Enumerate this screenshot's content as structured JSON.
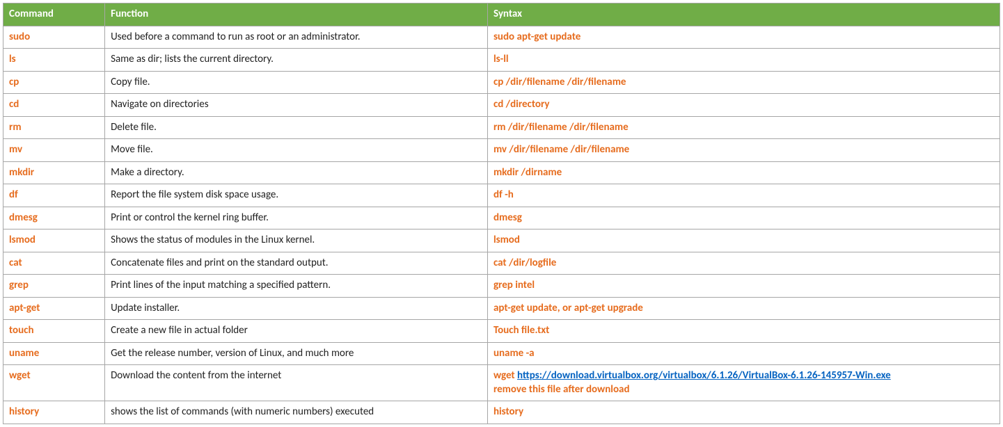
{
  "headers": {
    "command": "Command",
    "function": "Function",
    "syntax": "Syntax"
  },
  "rows": [
    {
      "command": "sudo",
      "function": "Used before a command to run as root or an administrator.",
      "syntax": "sudo apt-get update"
    },
    {
      "command": "ls",
      "function": "Same as dir; lists the current directory.",
      "syntax": "ls-ll"
    },
    {
      "command": "cp",
      "function": "Copy file.",
      "syntax": "cp /dir/filename /dir/filename"
    },
    {
      "command": "cd",
      "function": "Navigate on directories",
      "syntax": "cd  /directory"
    },
    {
      "command": "rm",
      "function": "Delete file.",
      "syntax": "rm /dir/filename /dir/filename"
    },
    {
      "command": "mv",
      "function": "Move file.",
      "syntax": "mv /dir/filename /dir/filename"
    },
    {
      "command": "mkdir",
      "function": "Make a directory.",
      "syntax": "mkdir /dirname"
    },
    {
      "command": "df",
      "function": "Report the file system disk space usage.",
      "syntax": "df -h"
    },
    {
      "command": "dmesg",
      "function": "Print or control the kernel ring buffer.",
      "syntax": "dmesg"
    },
    {
      "command": "lsmod",
      "function": "Shows the status of modules in the Linux kernel.",
      "syntax": "lsmod"
    },
    {
      "command": "cat",
      "function": "Concatenate files and print on the standard output.",
      "syntax": "cat /dir/logfile"
    },
    {
      "command": "grep",
      "function": "Print lines of the input matching a specified pattern.",
      "syntax": "grep intel"
    },
    {
      "command": "apt-get",
      "function": "Update installer.",
      "syntax": "apt-get update, or apt-get upgrade"
    },
    {
      "command": "touch",
      "function": "Create a new file in actual folder",
      "syntax": "Touch file.txt"
    },
    {
      "command": "uname",
      "function": "Get the release number, version of Linux, and much more",
      "syntax": "uname -a"
    },
    {
      "command": "wget",
      "function": "Download the content from the internet",
      "syntax_prefix": "wget ",
      "syntax_link": "https://download.virtualbox.org/virtualbox/6.1.26/VirtualBox-6.1.26-145957-Win.exe",
      "syntax_extra": "remove this file after download"
    },
    {
      "command": "history",
      "function": "shows the list of commands (with numeric numbers) executed",
      "syntax": "history"
    }
  ]
}
